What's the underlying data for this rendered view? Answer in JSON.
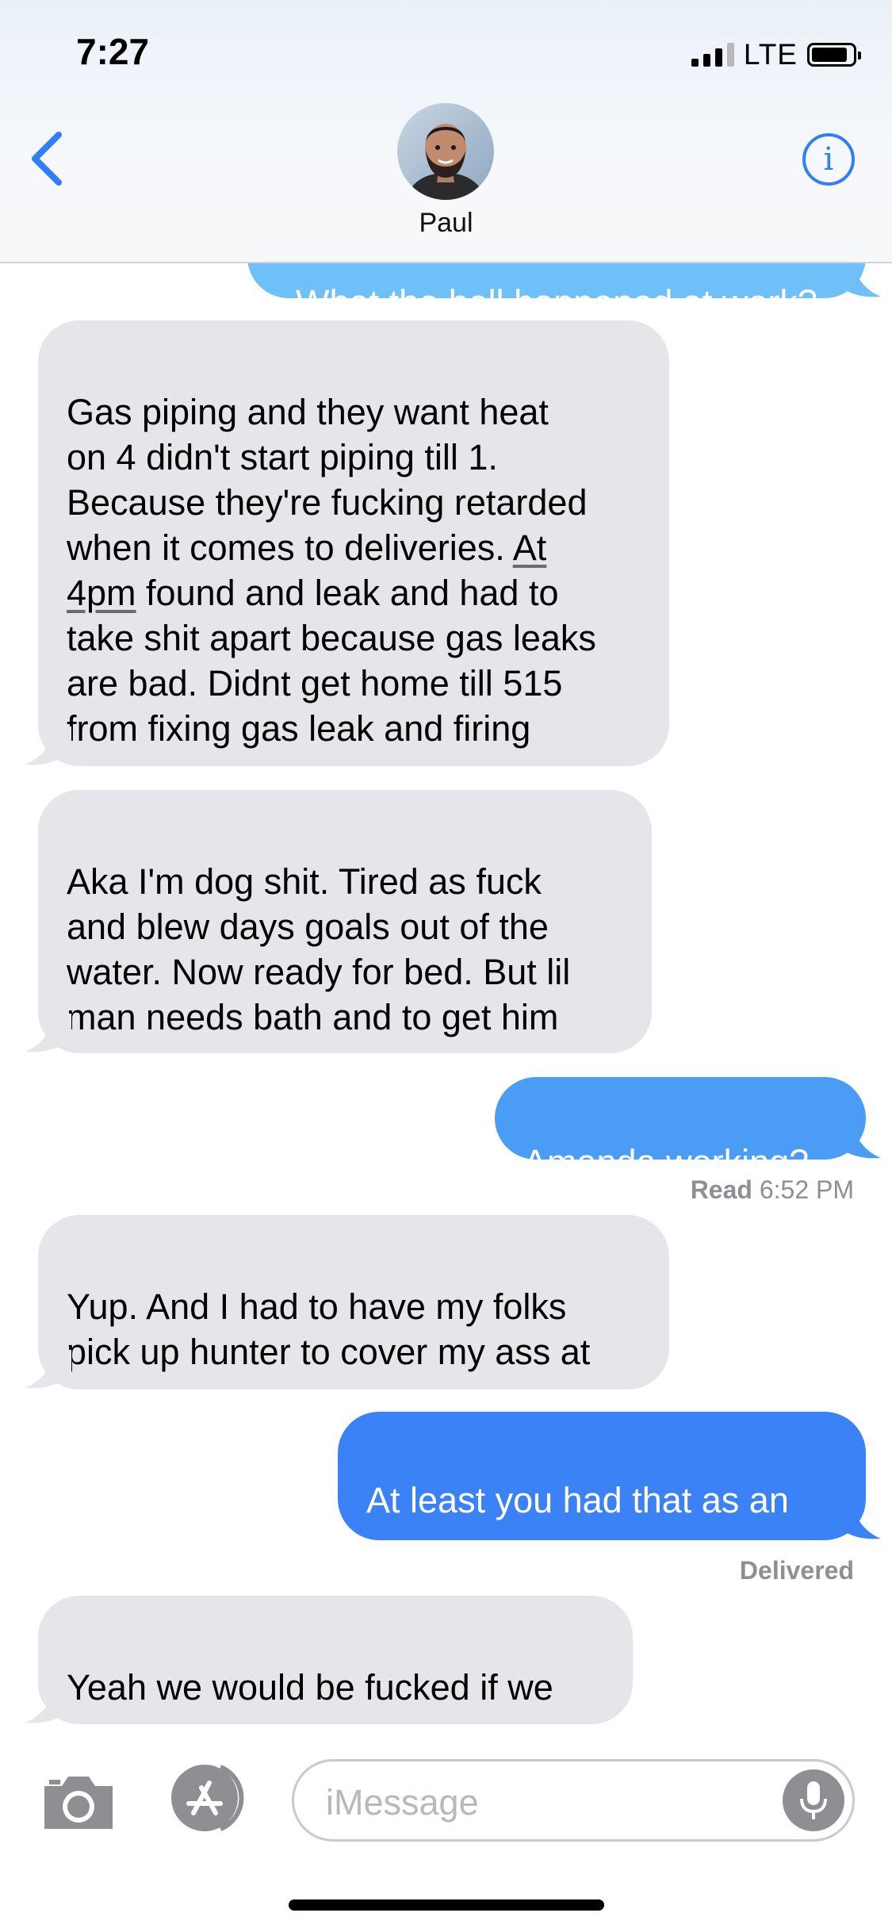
{
  "status": {
    "time": "7:27",
    "network": "LTE"
  },
  "header": {
    "contact_name": "Paul",
    "info_symbol": "i"
  },
  "messages": [
    {
      "dir": "out",
      "text": "What the hell happened at work?"
    },
    {
      "dir": "in",
      "text_a": "Gas piping and they want heat\non 4 didn't start piping till 1.\nBecause they're fucking retarded\nwhen it comes to deliveries. ",
      "text_u": "At\n4pm",
      "text_b": " found and leak and had to\ntake shit apart because gas leaks\nare bad.  Didnt get home till 515\nfrom fixing gas leak and firing"
    },
    {
      "dir": "in",
      "text": "Aka I'm dog shit. Tired as fuck\nand blew days goals out of the\nwater. Now ready for bed. But lil\nman needs bath and to get him"
    },
    {
      "dir": "out",
      "text": "Amanda working?"
    },
    {
      "dir": "in",
      "text": "Yup. And I had to have my folks\npick up hunter to cover my ass at"
    },
    {
      "dir": "out",
      "text": "At least you had that as an"
    },
    {
      "dir": "in",
      "text": "Yeah we would be fucked if we"
    }
  ],
  "receipts": {
    "read_label": "Read",
    "read_time": "6:52 PM",
    "delivered": "Delivered"
  },
  "input": {
    "placeholder": "iMessage"
  },
  "colors": {
    "accent": "#2f7ff7",
    "incoming": "#e5e5ea",
    "outgoing_top": "#6fc0f8",
    "outgoing_mid": "#4a9cf5",
    "outgoing_bottom": "#3b82f6"
  }
}
